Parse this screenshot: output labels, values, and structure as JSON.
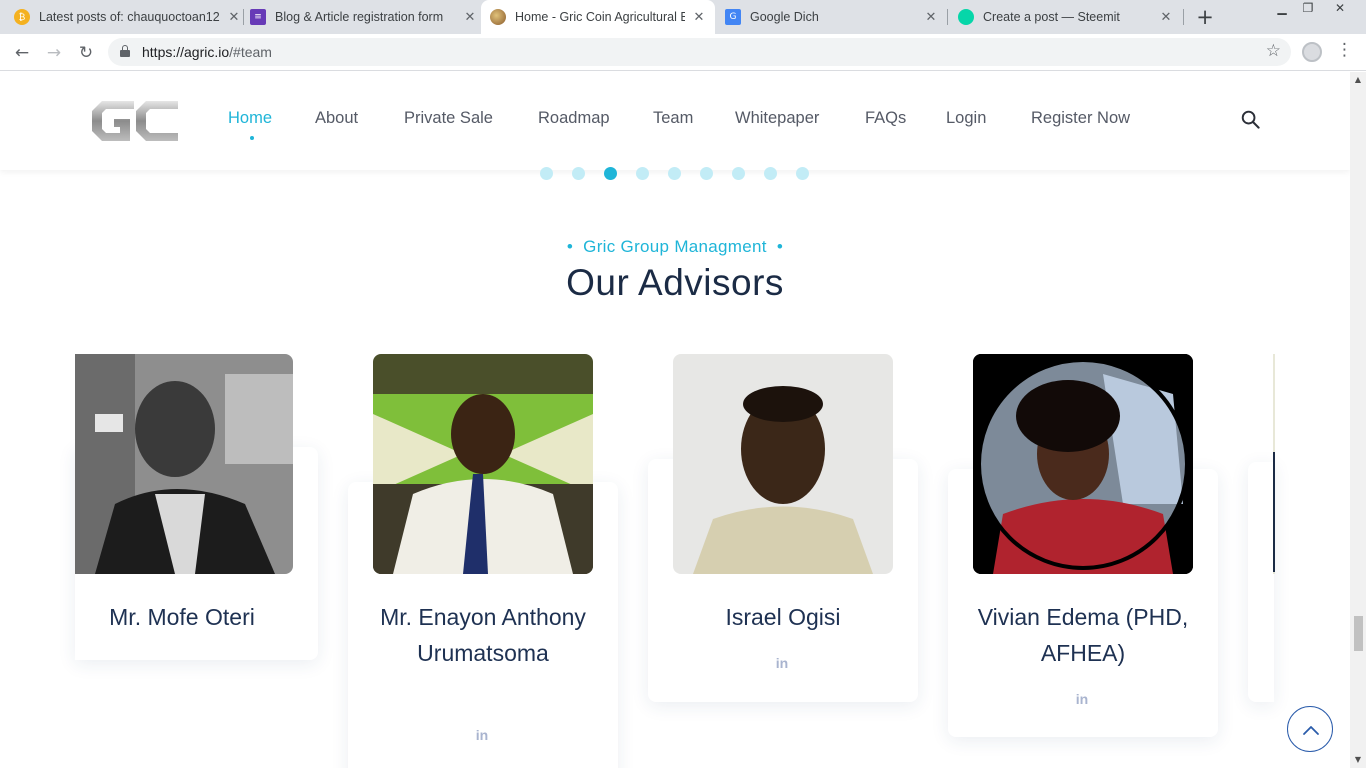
{
  "browser": {
    "tabs": [
      {
        "title": "Latest posts of: chauquoctoan12",
        "favicon": "bitcoin-icon",
        "color": "#f4b120"
      },
      {
        "title": "Blog & Article registration form",
        "favicon": "forms-icon",
        "color": "#673ab7"
      },
      {
        "title": "Home - Gric Coin Agricultural Bl",
        "favicon": "gric-icon",
        "color": "#b5844a"
      },
      {
        "title": "Google Dich",
        "favicon": "translate-icon",
        "color": "#4285f4"
      },
      {
        "title": "Create a post — Steemit",
        "favicon": "steemit-icon",
        "color": "#06d6a9"
      }
    ],
    "url_host": "https://agric.io",
    "url_path": "/#team"
  },
  "nav": {
    "items": [
      "Home",
      "About",
      "Private Sale",
      "Roadmap",
      "Team",
      "Whitepaper",
      "FAQs",
      "Login",
      "Register Now"
    ],
    "active": "Home"
  },
  "carousel": {
    "dot_count": 9,
    "active_index": 2
  },
  "section": {
    "eyebrow": "Gric Group Managment",
    "title": "Our Advisors"
  },
  "advisors": [
    {
      "name": "Mr. Mofe Oteri",
      "linkedin": ""
    },
    {
      "name": "Mr. Enayon Anthony Urumatsoma",
      "linkedin": "in"
    },
    {
      "name": "Israel Ogisi",
      "linkedin": "in"
    },
    {
      "name": "Vivian Edema (PHD, AFHEA)",
      "linkedin": "in"
    }
  ],
  "colors": {
    "accent": "#1fb5d8",
    "heading": "#1b2b45",
    "text": "#555a66"
  }
}
